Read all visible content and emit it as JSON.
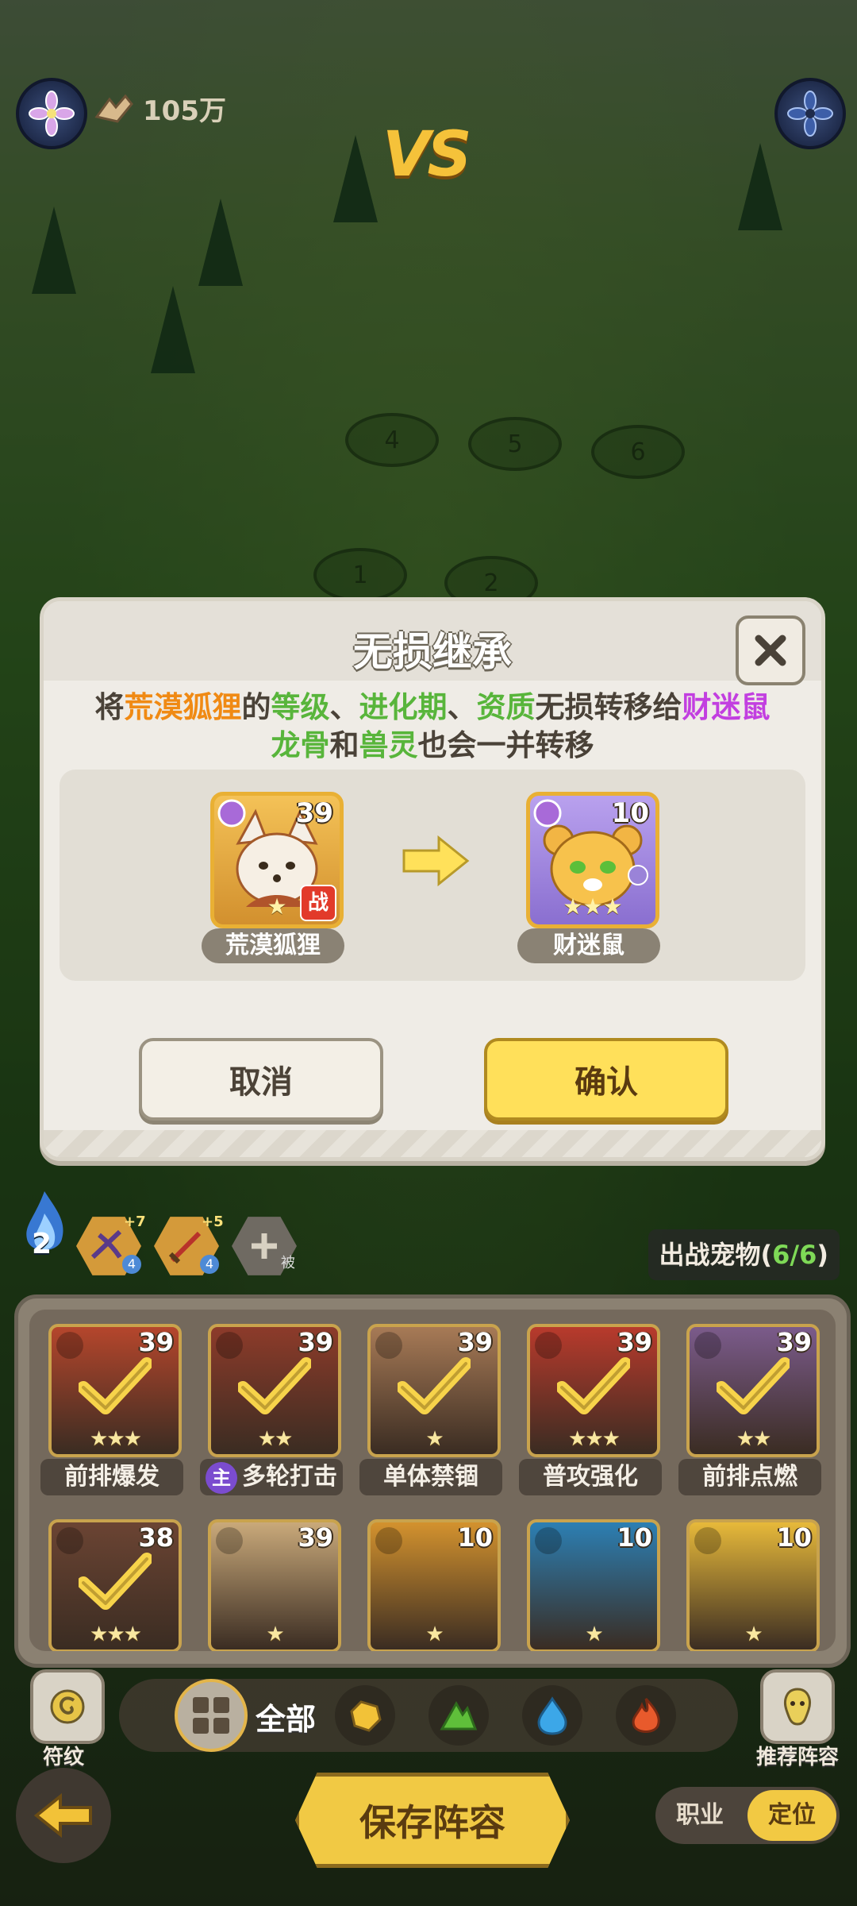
{
  "top_bar": {
    "power_value": "105万",
    "vs_label": "VS"
  },
  "battle_slots": [
    "4",
    "5",
    "6",
    "1",
    "2"
  ],
  "modal": {
    "title": "无损继承",
    "desc_line1": [
      {
        "text": "将",
        "style": "normal"
      },
      {
        "text": "荒漠狐狸",
        "style": "orange"
      },
      {
        "text": "的",
        "style": "normal"
      },
      {
        "text": "等级",
        "style": "green"
      },
      {
        "text": "、",
        "style": "normal"
      },
      {
        "text": "进化期",
        "style": "green"
      },
      {
        "text": "、",
        "style": "normal"
      },
      {
        "text": "资质",
        "style": "green"
      },
      {
        "text": "无损转移给",
        "style": "normal"
      },
      {
        "text": "财迷鼠",
        "style": "purple"
      }
    ],
    "desc_line2": [
      {
        "text": "龙骨",
        "style": "green"
      },
      {
        "text": "和",
        "style": "normal"
      },
      {
        "text": "兽灵",
        "style": "green"
      },
      {
        "text": "也会一并转移",
        "style": "normal"
      }
    ],
    "source_pet": {
      "name": "荒漠狐狸",
      "level": "39",
      "stars": "★",
      "battle_tag": "战"
    },
    "target_pet": {
      "name": "财迷鼠",
      "level": "10",
      "stars": "★★★"
    },
    "cancel_label": "取消",
    "confirm_label": "确认"
  },
  "team_bar": {
    "spirit_count": "2",
    "rune_slots": [
      {
        "level": "+7",
        "badge": "4"
      },
      {
        "level": "+5",
        "badge": "4"
      }
    ],
    "add_slot_tag": "被",
    "pet_count_label": "出战宠物(",
    "pet_count_value": "6/6",
    "pet_count_close": ")"
  },
  "roster": [
    {
      "level": "39",
      "stars": "★★★",
      "label": "前排爆发",
      "selected": true,
      "color": "#b5462c"
    },
    {
      "level": "39",
      "stars": "★★",
      "label": "多轮打击",
      "main_tag": "主",
      "selected": true,
      "color": "#8d3b2a"
    },
    {
      "level": "39",
      "stars": "★",
      "label": "单体禁锢",
      "selected": true,
      "color": "#a77a56"
    },
    {
      "level": "39",
      "stars": "★★★",
      "label": "普攻强化",
      "selected": true,
      "color": "#b83a2c"
    },
    {
      "level": "39",
      "stars": "★★",
      "label": "前排点燃",
      "selected": true,
      "color": "#7b5b8b"
    },
    {
      "level": "38",
      "stars": "★★★",
      "label": "",
      "selected": true,
      "color": "#6b4433"
    },
    {
      "level": "39",
      "stars": "★",
      "label": "",
      "selected": false,
      "color": "#c9a97a"
    },
    {
      "level": "10",
      "stars": "★",
      "label": "",
      "selected": false,
      "color": "#d3922e"
    },
    {
      "level": "10",
      "stars": "★",
      "label": "",
      "selected": false,
      "color": "#2c7fb3"
    },
    {
      "level": "10",
      "stars": "★",
      "label": "",
      "selected": false,
      "color": "#e7b93a"
    }
  ],
  "filters": {
    "rune_label": "符纹",
    "all_label": "全部",
    "recommend_label": "推荐阵容"
  },
  "bottom": {
    "save_label": "保存阵容",
    "seg_job": "职业",
    "seg_position": "定位"
  },
  "colors": {
    "accent_yellow": "#ffe05a",
    "highlight_orange": "#f08a14",
    "highlight_green": "#58b53b",
    "highlight_purple": "#c23fe0"
  }
}
